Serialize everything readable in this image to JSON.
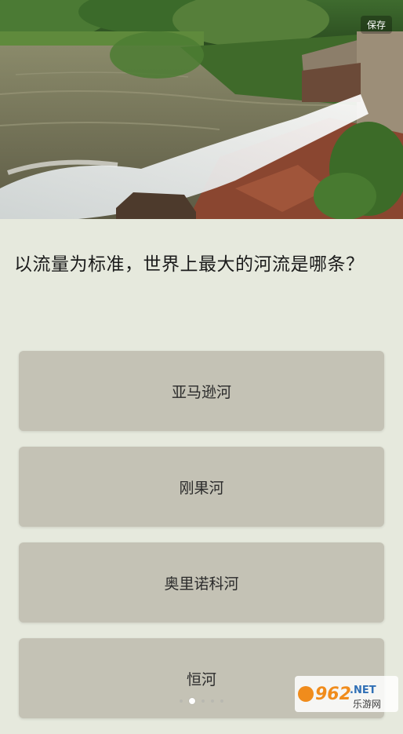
{
  "header": {
    "save_label": "保存"
  },
  "question": {
    "text": "以流量为标准，世界上最大的河流是哪条？"
  },
  "options": [
    {
      "label": "亚马逊河"
    },
    {
      "label": "刚果河"
    },
    {
      "label": "奥里诺科河"
    },
    {
      "label": "恒河"
    }
  ],
  "pager": {
    "count": 5,
    "active_index": 1
  },
  "watermark": {
    "logo_text": "962.NET",
    "sub_text": "乐游网"
  },
  "colors": {
    "background": "#e6e9dd",
    "option_bg": "#c4c2b5",
    "question_text": "#1b1b1b"
  }
}
